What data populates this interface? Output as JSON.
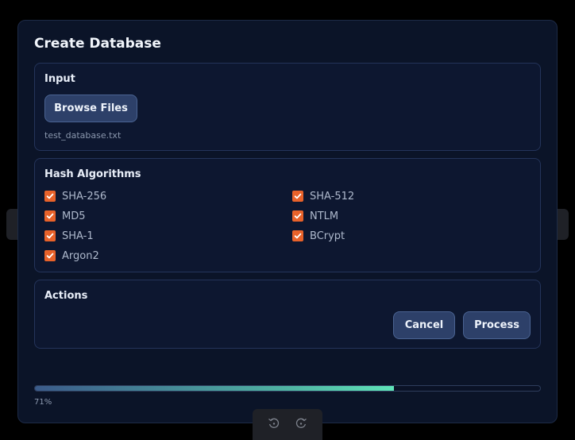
{
  "dialog": {
    "title": "Create Database"
  },
  "input_section": {
    "label": "Input",
    "browse_label": "Browse Files",
    "filename": "test_database.txt"
  },
  "hash_section": {
    "label": "Hash Algorithms",
    "algorithms": [
      {
        "label": "SHA-256",
        "checked": true
      },
      {
        "label": "SHA-512",
        "checked": true
      },
      {
        "label": "MD5",
        "checked": true
      },
      {
        "label": "NTLM",
        "checked": true
      },
      {
        "label": "SHA-1",
        "checked": true
      },
      {
        "label": "BCrypt",
        "checked": true
      },
      {
        "label": "Argon2",
        "checked": true
      }
    ]
  },
  "actions_section": {
    "label": "Actions",
    "cancel_label": "Cancel",
    "process_label": "Process"
  },
  "progress": {
    "fraction": 0.71,
    "text": "71%"
  },
  "nav": {
    "prev_icon": "chevron-left-icon",
    "next_icon": "chevron-right-icon",
    "rotate_left_icon": "rotate-left-icon",
    "rotate_right_icon": "rotate-right-icon"
  },
  "colors": {
    "accent_checkbox": "#e8622a",
    "button_bg": "#2d4069",
    "progress_end": "#5fe3b8"
  }
}
